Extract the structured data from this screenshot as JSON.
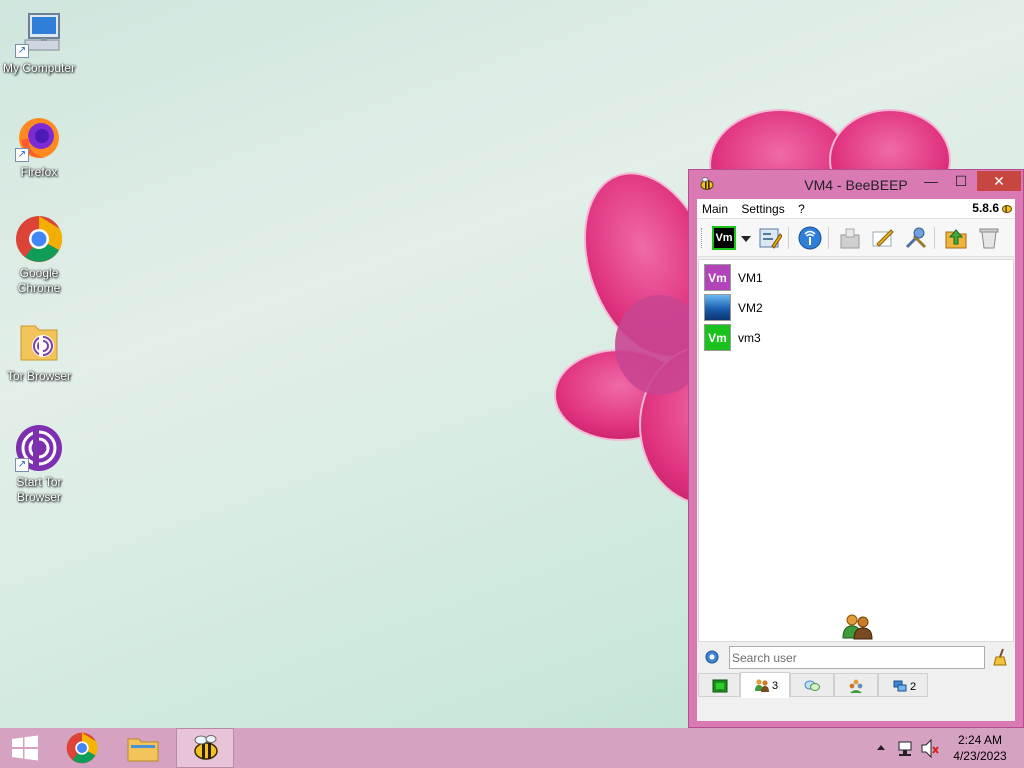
{
  "desktop": {
    "icons": [
      {
        "label": "My Computer"
      },
      {
        "label": "Firefox"
      },
      {
        "label": "Google Chrome"
      },
      {
        "label": "Tor Browser"
      },
      {
        "label": "Start Tor Browser"
      }
    ]
  },
  "window": {
    "title": "VM4 - BeeBEEP",
    "minimize": "—",
    "maximize": "☐",
    "close": "✕",
    "menu": [
      "Main",
      "Settings",
      "?"
    ],
    "version": "5.8.6",
    "toolbar": {
      "status_avatar": "Vm"
    },
    "users": [
      {
        "avatar": "Vm",
        "name": "VM1",
        "color": "#b044b8"
      },
      {
        "avatar": "",
        "name": "VM2",
        "color": "#1a5fb0"
      },
      {
        "avatar": "Vm",
        "name": "vm3",
        "color": "#19c21c"
      }
    ],
    "search": {
      "placeholder": "Search user",
      "value": ""
    },
    "tabs": [
      {
        "icon": "status-icon",
        "count": ""
      },
      {
        "icon": "users-icon",
        "count": "3"
      },
      {
        "icon": "chats-icon",
        "count": ""
      },
      {
        "icon": "groups-icon",
        "count": ""
      },
      {
        "icon": "shares-icon",
        "count": "2"
      }
    ]
  },
  "taskbar": {
    "clock_time": "2:24 AM",
    "clock_date": "4/23/2023"
  },
  "colors": {
    "window_frame": "#d97ab5",
    "taskbar": "#d6a2c1",
    "close_button": "#c7463f"
  }
}
